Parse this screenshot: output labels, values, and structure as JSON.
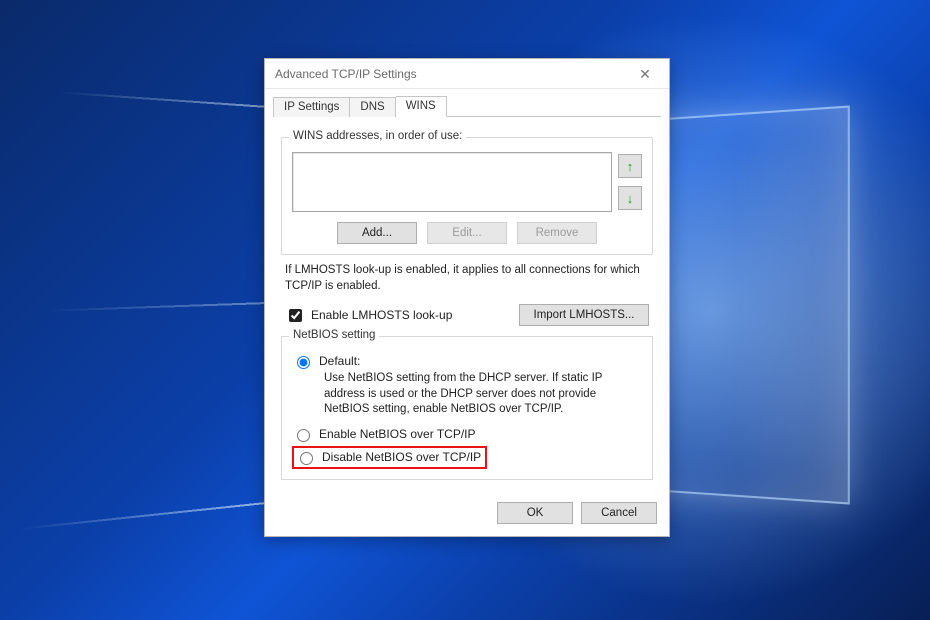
{
  "window": {
    "title": "Advanced TCP/IP Settings"
  },
  "tabs": {
    "ip_settings": "IP Settings",
    "dns": "DNS",
    "wins": "WINS"
  },
  "wins": {
    "addresses_label": "WINS addresses, in order of use:",
    "add_btn": "Add...",
    "edit_btn": "Edit...",
    "remove_btn": "Remove"
  },
  "lmhosts": {
    "note": "If LMHOSTS look-up is enabled, it applies to all connections for which TCP/IP is enabled.",
    "checkbox": "Enable LMHOSTS look-up",
    "import_btn": "Import LMHOSTS..."
  },
  "netbios": {
    "legend": "NetBIOS setting",
    "default_label": "Default:",
    "default_desc": "Use NetBIOS setting from the DHCP server. If static IP address is used or the DHCP server does not provide NetBIOS setting, enable NetBIOS over TCP/IP.",
    "enable_label": "Enable NetBIOS over TCP/IP",
    "disable_label": "Disable NetBIOS over TCP/IP"
  },
  "footer": {
    "ok": "OK",
    "cancel": "Cancel"
  }
}
